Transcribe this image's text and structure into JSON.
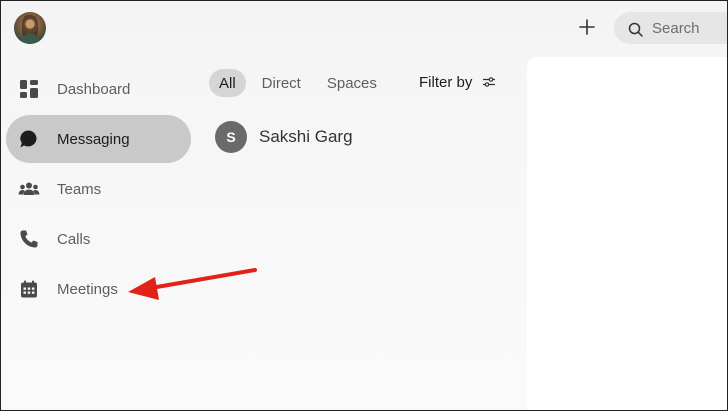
{
  "header": {
    "avatar_icon": "user-avatar",
    "new_icon": "plus-icon",
    "search_placeholder": "Search"
  },
  "sidebar": {
    "items": [
      {
        "label": "Dashboard",
        "icon": "dashboard-icon",
        "active": false
      },
      {
        "label": "Messaging",
        "icon": "chat-bubble-icon",
        "active": true
      },
      {
        "label": "Teams",
        "icon": "people-icon",
        "active": false
      },
      {
        "label": "Calls",
        "icon": "phone-icon",
        "active": false
      },
      {
        "label": "Meetings",
        "icon": "calendar-icon",
        "active": false
      }
    ]
  },
  "filters": {
    "tabs": [
      {
        "label": "All",
        "active": true
      },
      {
        "label": "Direct",
        "active": false
      },
      {
        "label": "Spaces",
        "active": false
      }
    ],
    "filter_by_label": "Filter by",
    "filter_icon": "filter-sliders-icon"
  },
  "conversations": [
    {
      "initial": "S",
      "name": "Sakshi Garg"
    }
  ],
  "annotation": {
    "arrow_color": "#e32119",
    "points_to": "Meetings"
  },
  "colors": {
    "active_nav_bg": "#c9c9c9",
    "active_pill_bg": "#d5d5d5",
    "avatar_initial_bg": "#6a6a6a"
  }
}
